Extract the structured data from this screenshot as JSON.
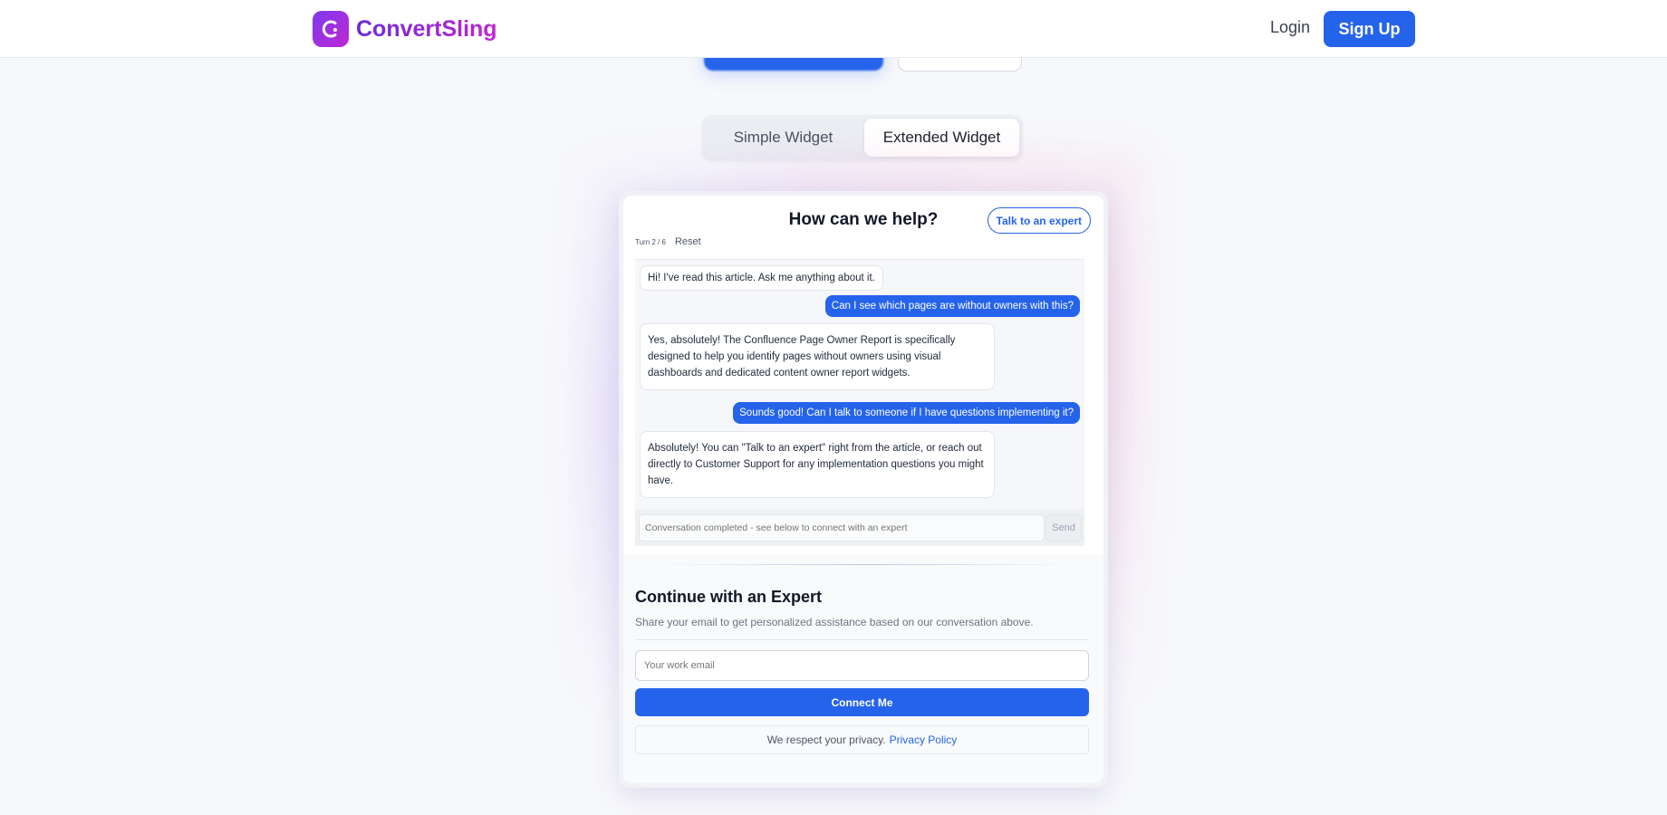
{
  "brand": {
    "name": "ConvertSling",
    "logo_icon": "c-logo-icon"
  },
  "nav": {
    "login_label": "Login",
    "signup_label": "Sign Up"
  },
  "tabs": [
    {
      "label": "Simple Widget",
      "active": false
    },
    {
      "label": "Extended Widget",
      "active": true
    }
  ],
  "chat": {
    "title": "How can we help?",
    "expert_button_label": "Talk to an expert",
    "turn_counter": "Turn 2 / 6",
    "reset_label": "Reset",
    "messages": [
      {
        "role": "bot",
        "text": "Hi! I've read this article. Ask me anything about it."
      },
      {
        "role": "user",
        "text": "Can I see which pages are without owners with this?"
      },
      {
        "role": "bot",
        "text": "Yes, absolutely! The Confluence Page Owner Report is specifically designed to help you identify pages without owners using visual dashboards and dedicated content owner report widgets."
      },
      {
        "role": "user",
        "text": "Sounds good! Can I talk to someone if I have questions implementing it?"
      },
      {
        "role": "bot",
        "text": "Absolutely! You can \"Talk to an expert\" right from the article, or reach out directly to Customer Support for any implementation questions you might have."
      }
    ],
    "input_placeholder": "Conversation completed - see below to connect with an expert",
    "send_label": "Send"
  },
  "expert": {
    "heading": "Continue with an Expert",
    "subtext": "Share your email to get personalized assistance based on our conversation above.",
    "email_placeholder": "Your work email",
    "connect_label": "Connect Me",
    "privacy_text": "We respect your privacy.",
    "privacy_link": "Privacy Policy"
  },
  "colors": {
    "primary": "#2563eb",
    "brand_start": "#7c3aed",
    "brand_end": "#c026d3"
  }
}
